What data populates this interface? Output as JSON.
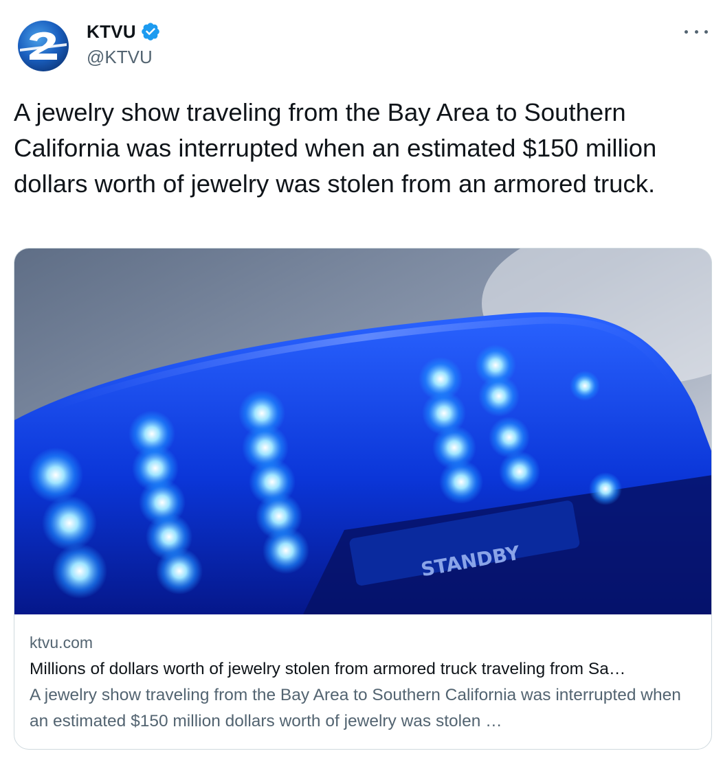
{
  "author": {
    "display_name": "KTVU",
    "handle": "@KTVU",
    "verified": true,
    "avatar_icon": "ktvu-2-logo"
  },
  "tweet": {
    "text": "A jewelry show traveling from the Bay Area to Southern California was interrupted when an estimated $150 million dollars worth of jewelry was stolen from an armored truck."
  },
  "card": {
    "image_label": "STANDBY",
    "domain": "ktvu.com",
    "title": "Millions of dollars worth of jewelry stolen from armored truck traveling from Sa…",
    "description": "A jewelry show traveling from the Bay Area to Southern California was interrupted when an estimated $150 million dollars worth of jewelry was stolen …"
  },
  "colors": {
    "text_primary": "#0f1419",
    "text_secondary": "#536471",
    "verified_blue": "#1d9bf0",
    "card_border": "#cfd9de",
    "brand_blue": "#1458b8"
  },
  "icons": {
    "verified": "verified-badge-icon",
    "more": "more-dots-icon"
  }
}
